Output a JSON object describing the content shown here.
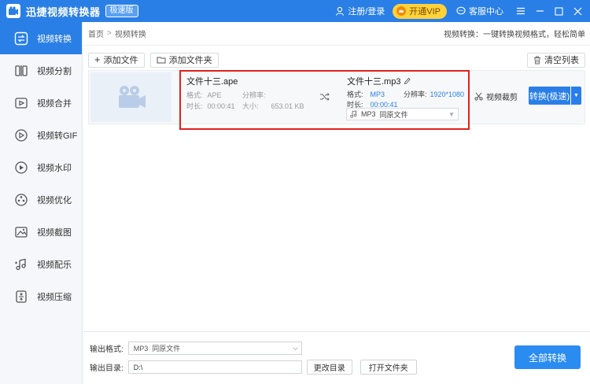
{
  "app": {
    "title": "迅捷视频转换器",
    "edition": "极速版",
    "login_label": "注册/登录",
    "vip_label": "开通VIP",
    "service_label": "客服中心"
  },
  "sidebar": {
    "items": [
      {
        "label": "视频转换",
        "icon": "convert-icon"
      },
      {
        "label": "视频分割",
        "icon": "split-icon"
      },
      {
        "label": "视频合并",
        "icon": "merge-icon"
      },
      {
        "label": "视频转GIF",
        "icon": "gif-icon"
      },
      {
        "label": "视频水印",
        "icon": "watermark-icon"
      },
      {
        "label": "视频优化",
        "icon": "optimize-icon"
      },
      {
        "label": "视频截图",
        "icon": "screenshot-icon"
      },
      {
        "label": "视频配乐",
        "icon": "music-icon"
      },
      {
        "label": "视频压缩",
        "icon": "compress-icon"
      }
    ]
  },
  "breadcrumb": {
    "home": "首页",
    "current": "视频转换",
    "hint": "视频转换：一键转换视频格式，轻松简单"
  },
  "toolbar": {
    "add_file": "添加文件",
    "add_folder": "添加文件夹",
    "clear_list": "清空列表"
  },
  "file": {
    "source_name": "文件十三.ape",
    "source_format_label": "格式:",
    "source_format": "APE",
    "source_resolution_label": "分辨率:",
    "source_resolution": "",
    "source_duration_label": "时长:",
    "source_duration": "00:00:41",
    "source_size_label": "大小:",
    "source_size": "653.01 KB",
    "target_name": "文件十三.mp3",
    "target_format_label": "格式:",
    "target_format": "MP3",
    "target_resolution_label": "分辨率:",
    "target_resolution": "1920*1080",
    "target_duration_label": "时长:",
    "target_duration": "00:00:41",
    "target_select_format": "MP3",
    "target_select_quality": "同原文件",
    "cut_label": "视频裁剪",
    "convert_label": "转换(极速)"
  },
  "bottom": {
    "output_format_label": "输出格式:",
    "output_format_value": "MP3",
    "output_format_quality": "同原文件",
    "output_dir_label": "输出目录:",
    "output_dir_value": "D:\\",
    "change_dir": "更改目录",
    "open_folder": "打开文件夹",
    "convert_all": "全部转换"
  },
  "colors": {
    "primary": "#2a7fe6",
    "vip": "#ffd23a",
    "highlight_box": "#e02020"
  }
}
